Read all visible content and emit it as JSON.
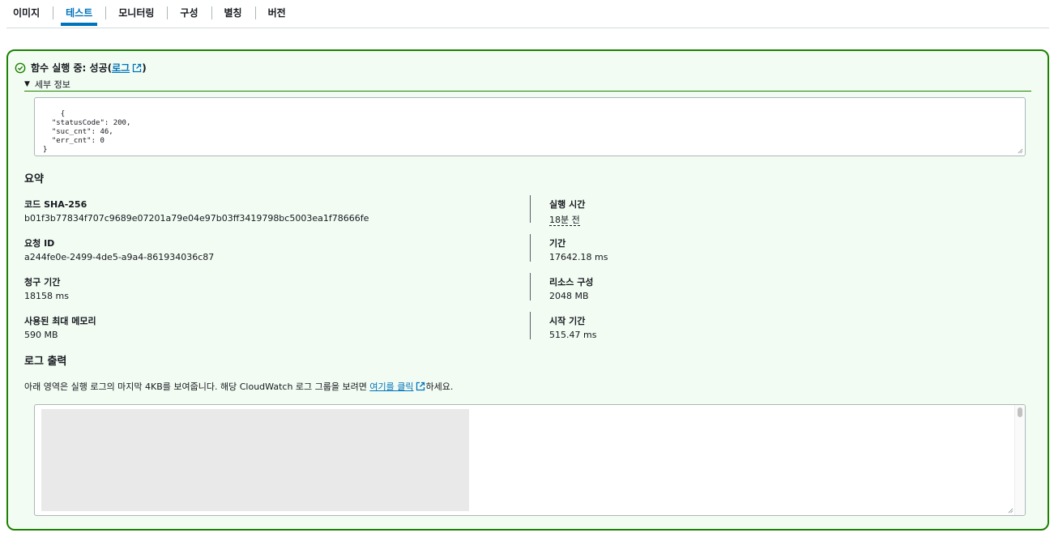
{
  "tabs": [
    {
      "label": "이미지",
      "active": false
    },
    {
      "label": "테스트",
      "active": true
    },
    {
      "label": "모니터링",
      "active": false
    },
    {
      "label": "구성",
      "active": false
    },
    {
      "label": "별칭",
      "active": false
    },
    {
      "label": "버전",
      "active": false
    }
  ],
  "result": {
    "status_prefix": "함수 실행 중: 성공(",
    "log_link": "로그",
    "status_suffix": ")",
    "details_label": "세부 정보",
    "response_json": "{\n  \"statusCode\": 200,\n  \"suc_cnt\": 46,\n  \"err_cnt\": 0\n}"
  },
  "summary": {
    "title": "요약",
    "code_sha_label": "코드 SHA-256",
    "code_sha_value": "b01f3b77834f707c9689e07201a79e04e97b03ff3419798bc5003ea1f78666fe",
    "exec_time_label": "실행 시간",
    "exec_time_value": "18분 전",
    "request_id_label": "요청 ID",
    "request_id_value": "a244fe0e-2499-4de5-a9a4-861934036c87",
    "duration_label": "기간",
    "duration_value": "17642.18 ms",
    "billed_label": "청구 기간",
    "billed_value": "18158 ms",
    "resources_label": "리소스 구성",
    "resources_value": "2048 MB",
    "max_mem_label": "사용된 최대 메모리",
    "max_mem_value": "590 MB",
    "init_label": "시작 기간",
    "init_value": "515.47 ms"
  },
  "log_output": {
    "title": "로그 출력",
    "desc_prefix": "아래 영역은 실행 로그의 마지막 4KB를 보여줍니다. 해당 CloudWatch 로그 그룹을 보려면 ",
    "desc_link": "여기를 클릭",
    "desc_suffix": "하세요."
  },
  "colors": {
    "success": "#1d8102",
    "panel_bg": "#f2fcf3",
    "link": "#0073bb"
  }
}
